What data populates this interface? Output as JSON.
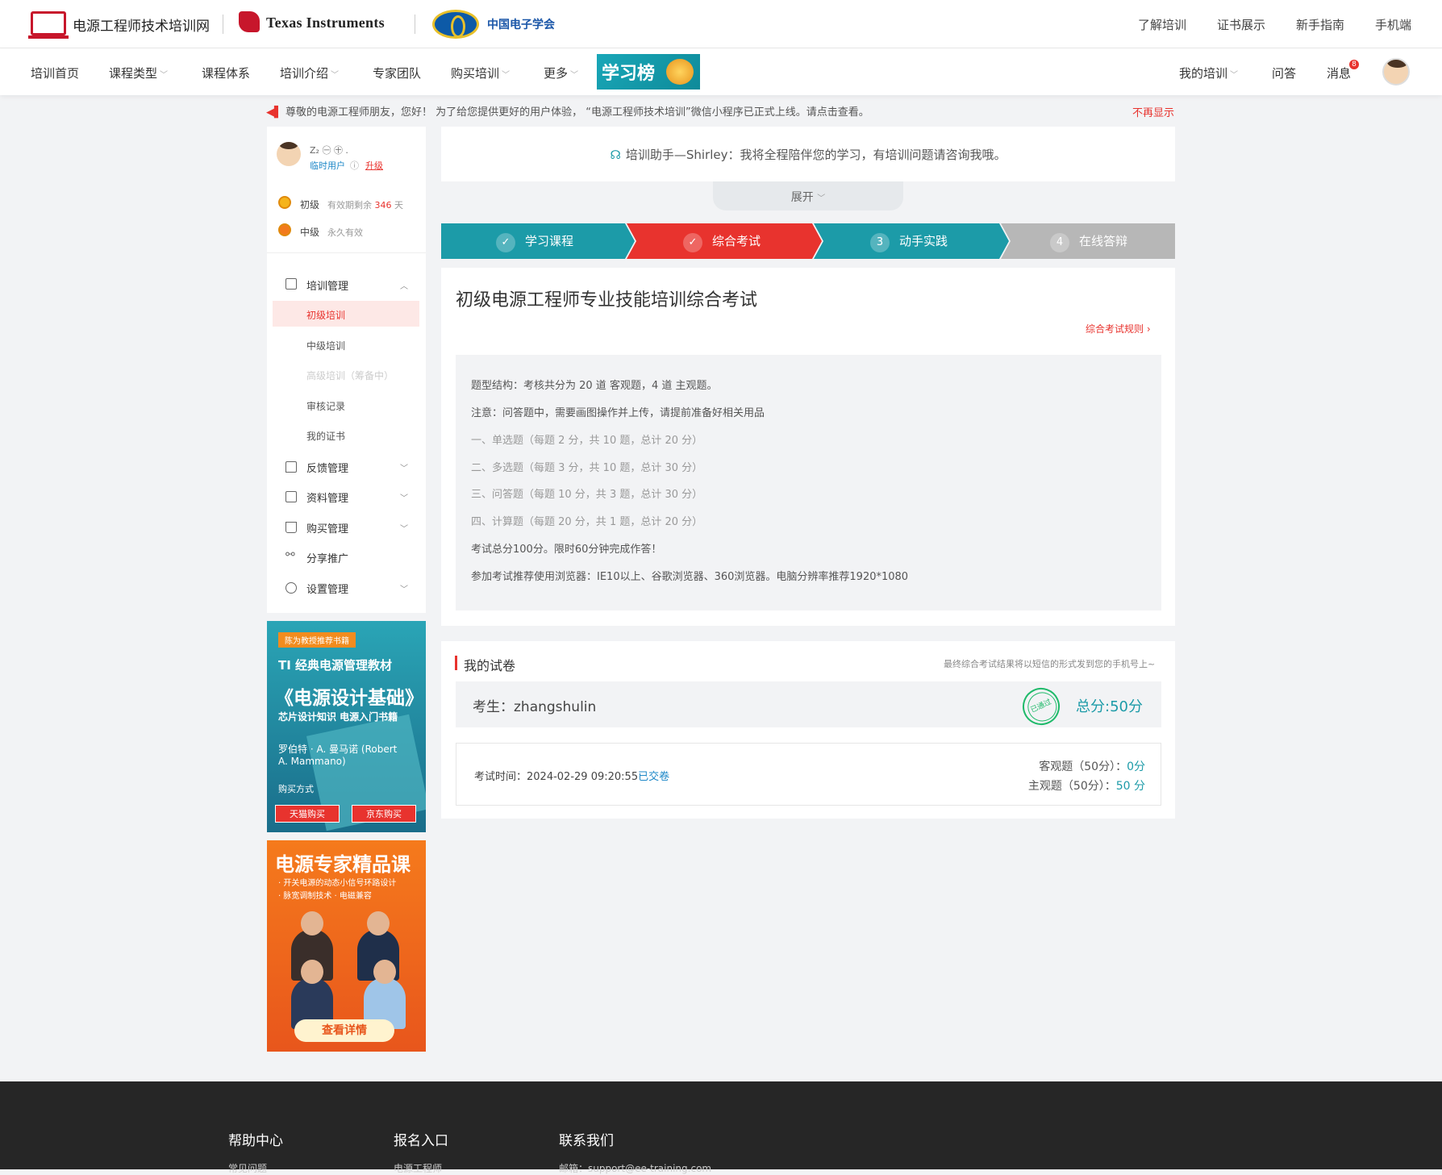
{
  "header": {
    "site_name": "电源工程师技术培训网",
    "ti_name": "Texas Instruments",
    "cie_name": "中国电子学会",
    "top_links": [
      "了解培训",
      "证书展示",
      "新手指南",
      "手机端"
    ]
  },
  "nav": {
    "items": [
      "培训首页",
      "课程类型",
      "课程体系",
      "培训介绍",
      "专家团队",
      "购买培训",
      "更多"
    ],
    "banner": "学习榜",
    "right": [
      "我的培训",
      "问答",
      "消息"
    ],
    "msg_count": "8"
  },
  "notice": {
    "text": "尊敬的电源工程师朋友，您好！ 为了给您提供更好的用户体验， “电源工程师技术培训”微信小程序已正式上线。请点击查看。",
    "dismiss": "不再显示"
  },
  "sidebar": {
    "user_name": "Z₂ ㊀ ㊉ .",
    "user_type": "临时用户",
    "upgrade": "升级",
    "levels": [
      {
        "name": "初级",
        "validity_prefix": "有效期剩余",
        "days": "346",
        "unit": "天"
      },
      {
        "name": "中级",
        "validity": "永久有效"
      }
    ],
    "groups": {
      "training": "培训管理",
      "training_items": [
        "初级培训",
        "中级培训",
        "高级培训（筹备中）",
        "审核记录",
        "我的证书"
      ],
      "feedback": "反馈管理",
      "materials": "资料管理",
      "purchase": "购买管理",
      "share": "分享推广",
      "settings": "设置管理"
    },
    "ad1": {
      "tag": "陈为教授推荐书籍",
      "title1": "TI 经典电源管理教材",
      "title2": "《电源设计基础》",
      "subtitle": "芯片设计知识 电源入门书籍",
      "author": "罗伯特 · A. 曼马诺 (Robert A. Mammano)",
      "buy_label": "购买方式",
      "buy_tmall": "天猫购买",
      "buy_jd": "京东购买"
    },
    "ad2": {
      "title": "电源专家精品课",
      "line1": "· 开关电源的动态小信号环路设计",
      "line2": "· 脉宽调制技术 · 电磁兼容",
      "button": "查看详情"
    }
  },
  "assistant": {
    "text": "培训助手—Shirley：我将全程陪伴您的学习，有培训问题请咨询我哦。",
    "expand": "展开"
  },
  "steps": [
    {
      "num": "✓",
      "label": "学习课程",
      "color": "#1c9ba8"
    },
    {
      "num": "✓",
      "label": "综合考试",
      "color": "#e8332e"
    },
    {
      "num": "3",
      "label": "动手实践",
      "color": "#1c9ba8"
    },
    {
      "num": "4",
      "label": "在线答辩",
      "color": "#b7b7b7"
    }
  ],
  "exam": {
    "title": "初级电源工程师专业技能培训综合考试",
    "rules_link": "综合考试规则",
    "rules": [
      "题型结构：考核共分为 20 道 客观题，4 道 主观题。",
      "注意：问答题中，需要画图操作并上传，请提前准备好相关用品",
      "一、单选题（每题 2 分，共 10 题，总计 20 分）",
      "二、多选题（每题 3 分，共 10 题，总计 30 分）",
      "三、问答题（每题 10 分，共 3 题，总计 30 分）",
      "四、计算题（每题 20 分，共 1 题，总计 20 分）",
      "考试总分100分。限时60分钟完成作答！",
      "参加考试推荐使用浏览器：IE10以上、谷歌浏览器、360浏览器。电脑分辨率推荐1920*1080"
    ]
  },
  "my_paper": {
    "title": "我的试卷",
    "note": "最终综合考试结果将以短信的形式发到您的手机号上~",
    "candidate_label": "考生：zhangshulin",
    "stamp": "已通过",
    "total": "总分:50分",
    "time_label": "考试时间：",
    "time": "2024-02-29 09:20:55",
    "submitted": "已交卷",
    "objective_label": "客观题（50分）：",
    "objective_score": "0分",
    "subjective_label": "主观题（50分）：",
    "subjective_score": "50 分"
  },
  "footer": {
    "cols": [
      "帮助中心",
      "报名入口",
      "联系我们"
    ],
    "links": [
      "常见问题",
      "电源工程师",
      "邮箱：support@ee-training.com"
    ]
  }
}
